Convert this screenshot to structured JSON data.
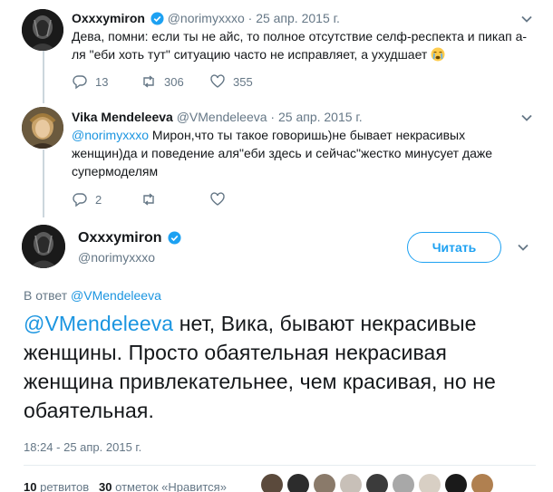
{
  "tweet1": {
    "name": "Oxxxymiron",
    "handle": "@norimyxxxo",
    "dot": "·",
    "date": "25 апр. 2015 г.",
    "text": "Дева, помни: если ты не айс, то полное отсутствие селф-респекта и пикап а-ля \"еби хоть тут\" ситуацию часто не исправляет, а ухудшает",
    "emoji": "crying-face",
    "replies": "13",
    "retweets": "306",
    "likes": "355"
  },
  "tweet2": {
    "name": "Vika Mendeleeva",
    "handle": "@VMendeleeva",
    "dot": "·",
    "date": "25 апр. 2015 г.",
    "mention": "@norimyxxxo",
    "text": " Мирон,что ты такое говоришь)не бывает некрасивых женщин)да и поведение аля\"еби здесь и сейчас\"жестко минусует даже супермоделям",
    "replies": "2",
    "retweets": "",
    "likes": ""
  },
  "main": {
    "name": "Oxxxymiron",
    "handle": "@norimyxxxo",
    "follow_label": "Читать",
    "reply_prefix": "В ответ ",
    "reply_to": "@VMendeleeva",
    "mention": "@VMendeleeva",
    "text": " нет, Вика, бывают некрасивые женщины. Просто обаятельная некрасивая женщина привлекательнее, чем красивая, но не обаятельная.",
    "timestamp": "18:24 - 25 апр. 2015 г.",
    "retweet_count": "10",
    "retweet_label": "ретвитов",
    "like_count": "30",
    "like_label": "отметок «Нравится»"
  },
  "colors": {
    "link": "#1b95e0",
    "accent": "#1da1f2",
    "muted": "#657786",
    "text": "#14171a"
  }
}
